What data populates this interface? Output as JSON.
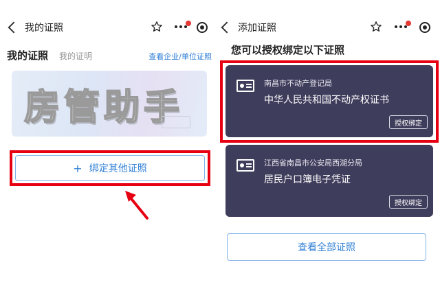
{
  "left": {
    "nav_title": "我的证照",
    "heading": "我的证照",
    "subheading": "我的证明",
    "link": "查看企业/单位证照",
    "banner_text": "房管助手",
    "bind_button": "绑定其他证照",
    "bind_plus": "+"
  },
  "right": {
    "nav_title": "添加证照",
    "question": "您可以授权绑定以下证照",
    "cards": [
      {
        "issuer": "南昌市不动产登记局",
        "name": "中华人民共和国不动产权证书",
        "button": "授权绑定"
      },
      {
        "issuer": "江西省南昌市公安局西湖分局",
        "name": "居民户口簿电子凭证",
        "button": "授权绑定"
      }
    ],
    "view_all": "查看全部证照"
  },
  "colors": {
    "highlight": "#e60012",
    "accent": "#2f7fd6",
    "card_bg": "#3f3d5c",
    "badge": "#e53935"
  },
  "icons": [
    "back-icon",
    "star-icon",
    "more-icon",
    "record-icon",
    "id-card-icon",
    "arrow-icon"
  ]
}
